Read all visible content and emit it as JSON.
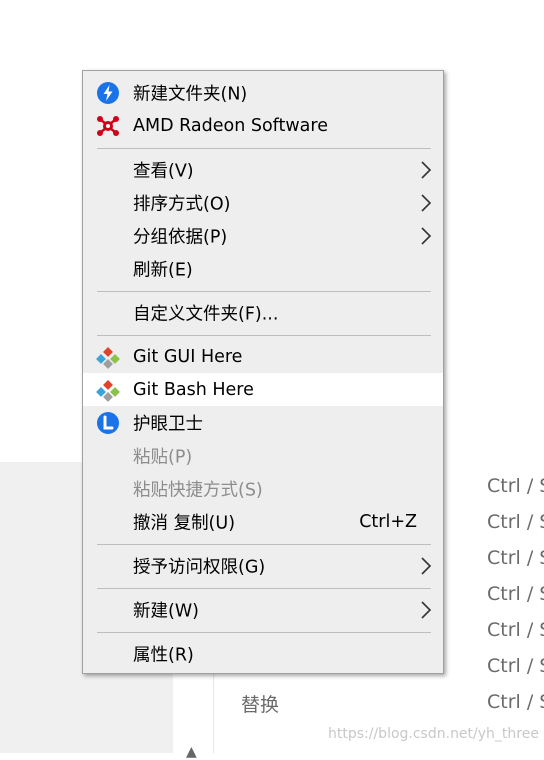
{
  "background": {
    "shortcuts": [
      "Ctrl / S",
      "Ctrl / S",
      "Ctrl / S",
      "Ctrl / S",
      "Ctrl / S",
      "Ctrl / S",
      "Ctrl / S"
    ],
    "replace_text": "替换",
    "watermark": "https://blog.csdn.net/yh_three"
  },
  "menu": {
    "new_folder": "新建文件夹(N)",
    "amd": "AMD Radeon Software",
    "view": "查看(V)",
    "sort": "排序方式(O)",
    "group": "分组依据(P)",
    "refresh": "刷新(E)",
    "customize": "自定义文件夹(F)...",
    "git_gui": "Git GUI Here",
    "git_bash": "Git Bash Here",
    "eye_guard": "护眼卫士",
    "paste": "粘贴(P)",
    "paste_shortcut": "粘贴快捷方式(S)",
    "undo_copy": "撤消 复制(U)",
    "undo_copy_shortcut": "Ctrl+Z",
    "give_access": "授予访问权限(G)",
    "new": "新建(W)",
    "properties": "属性(R)"
  },
  "colors": {
    "menu_bg": "#eeeeee",
    "hover_bg": "#ffffff",
    "disabled_text": "#8d8d8d",
    "accent_blue": "#1a73e8",
    "amd_red": "#d0021b"
  }
}
